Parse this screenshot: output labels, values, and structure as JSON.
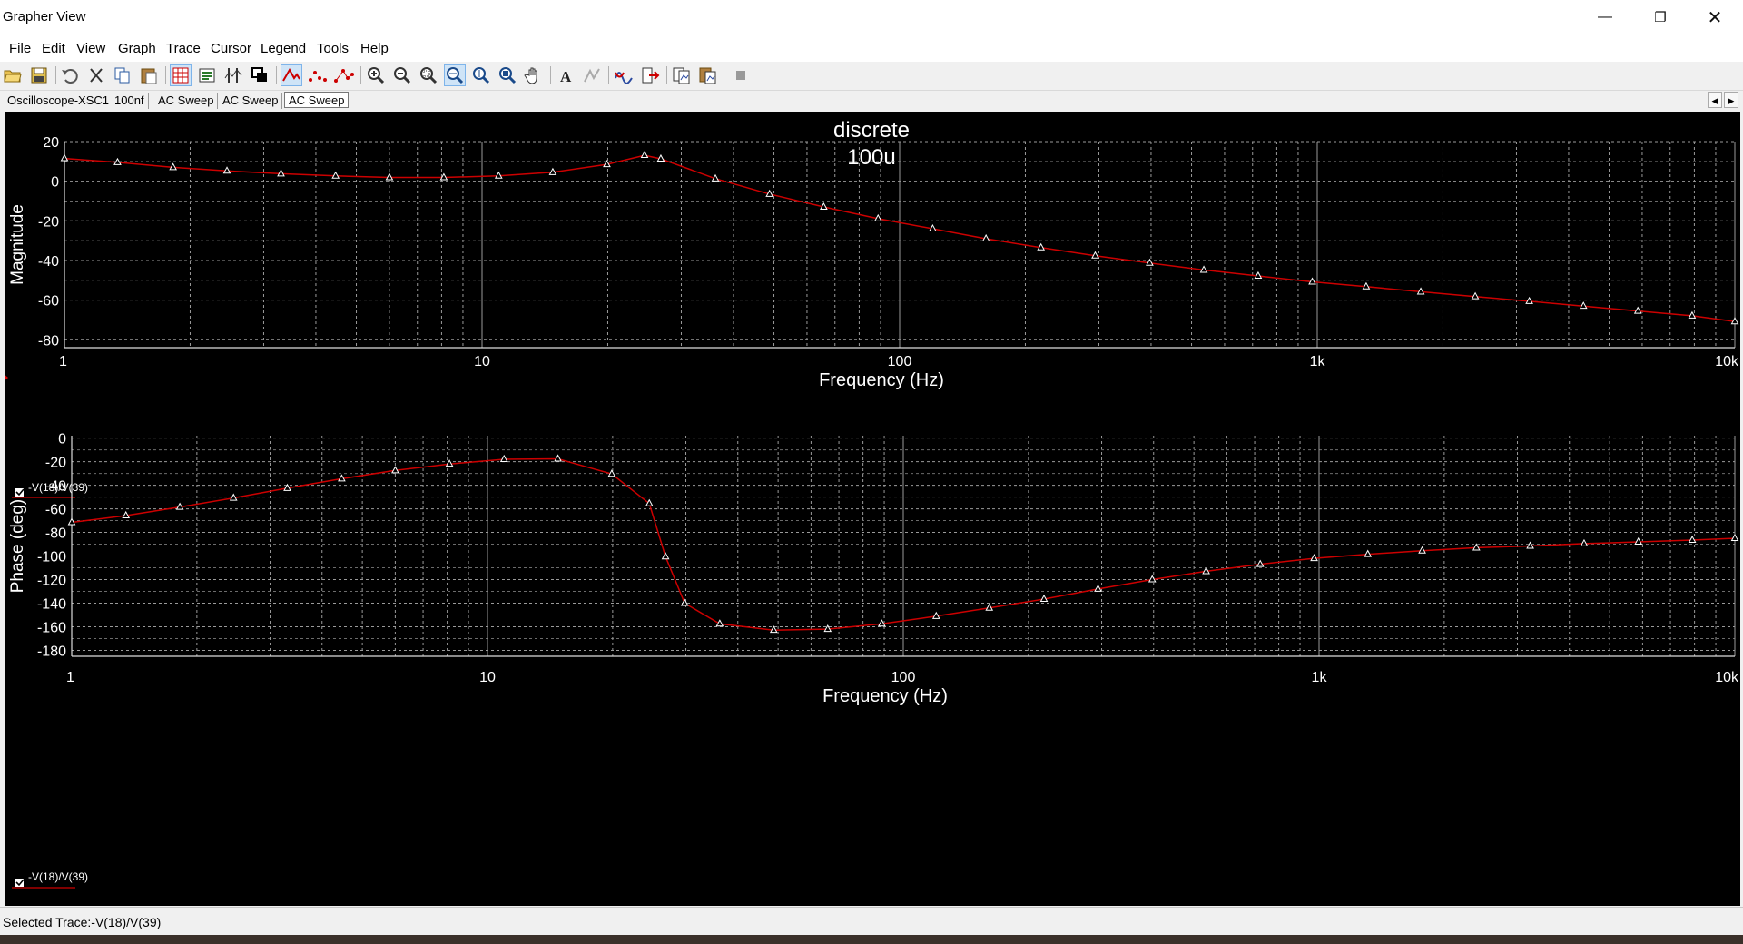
{
  "window": {
    "title": "Grapher View"
  },
  "menu": [
    "File",
    "Edit",
    "View",
    "Graph",
    "Trace",
    "Cursor",
    "Legend",
    "Tools",
    "Help"
  ],
  "toolbar_icons": [
    "open-icon",
    "save-icon",
    "undo-icon",
    "cut-icon",
    "copy-icon",
    "paste-icon",
    "grid-icon",
    "legend-icon",
    "cursors-icon",
    "overlay-icon",
    "lines-icon",
    "dots-icon",
    "dots-lines-icon",
    "zoom-in-icon",
    "zoom-out-icon",
    "zoom-area-icon",
    "zoom-x-icon",
    "zoom-y-icon",
    "zoom-full-icon",
    "pan-icon",
    "text-icon",
    "properties-icon",
    "reverse-colors-icon",
    "export-icon",
    "copy-graph-icon",
    "paste-graph-icon",
    "stop-icon"
  ],
  "tabs": [
    "Oscilloscope-XSC1",
    "100nf",
    "AC Sweep",
    "AC Sweep",
    "AC Sweep"
  ],
  "active_tab": 4,
  "plot": {
    "title_line1": "discrete",
    "title_line2": "100u",
    "background": "#000000",
    "trace_color": "#cc0000",
    "grid_color": "#9a9a9a",
    "text_color": "#ffffff"
  },
  "legend": {
    "label": "-V(18)/V(39)",
    "checked": true
  },
  "status": {
    "text": "Selected Trace:-V(18)/V(39)"
  },
  "chart_data": [
    {
      "type": "line",
      "title": "discrete 100u",
      "xlabel": "Frequency (Hz)",
      "ylabel": "Magnitude",
      "xscale": "log",
      "xlim": [
        1,
        10000
      ],
      "ylim": [
        -84,
        20
      ],
      "grid": true,
      "xticks": [
        {
          "v": 1,
          "t": "1"
        },
        {
          "v": 10,
          "t": "10"
        },
        {
          "v": 100,
          "t": "100"
        },
        {
          "v": 1000,
          "t": "1k"
        },
        {
          "v": 10000,
          "t": "10k"
        }
      ],
      "yticks": [
        20,
        0,
        -20,
        -40,
        -60,
        -80
      ],
      "series": [
        {
          "name": "-V(18)/V(39)",
          "x": [
            1,
            1.34,
            1.82,
            2.45,
            3.3,
            4.46,
            6.0,
            8.1,
            10.96,
            14.77,
            19.9,
            24.5,
            26.8,
            36.2,
            48.8,
            65.8,
            88.8,
            120,
            161,
            218,
            294,
            397,
            535,
            722,
            973,
            1310,
            1770,
            2390,
            3220,
            4340,
            5860,
            7900,
            10000
          ],
          "y": [
            11.5,
            9.5,
            7,
            5.2,
            3.8,
            2.7,
            1.9,
            1.9,
            2.7,
            4.5,
            8.5,
            13.1,
            11.3,
            1.3,
            -6.5,
            -13,
            -18.9,
            -24,
            -29,
            -33.5,
            -37.6,
            -41.3,
            -44.8,
            -47.8,
            -50.8,
            -53.2,
            -55.8,
            -58.2,
            -60.6,
            -63,
            -65.5,
            -67.9,
            -70.8
          ]
        }
      ]
    },
    {
      "type": "line",
      "xlabel": "Frequency (Hz)",
      "ylabel": "Phase (deg)",
      "xscale": "log",
      "xlim": [
        1,
        10000
      ],
      "ylim": [
        -185,
        2
      ],
      "grid": true,
      "xticks": [
        {
          "v": 1,
          "t": "1"
        },
        {
          "v": 10,
          "t": "10"
        },
        {
          "v": 100,
          "t": "100"
        },
        {
          "v": 1000,
          "t": "1k"
        },
        {
          "v": 10000,
          "t": "10k"
        }
      ],
      "yticks": [
        0,
        -20,
        -40,
        -60,
        -80,
        -100,
        -120,
        -140,
        -160,
        -180
      ],
      "series": [
        {
          "name": "-V(18)/V(39)",
          "x": [
            1,
            1.35,
            1.82,
            2.45,
            3.3,
            4.46,
            6.0,
            8.1,
            10.96,
            14.77,
            19.9,
            24.5,
            26.8,
            29.8,
            36.2,
            48.8,
            65.8,
            88.8,
            120,
            161,
            218,
            294,
            397,
            535,
            722,
            973,
            1310,
            1770,
            2390,
            3220,
            4340,
            5860,
            7900,
            10000
          ],
          "y": [
            -71.5,
            -65.7,
            -58.5,
            -50.8,
            -42.5,
            -34.5,
            -27.5,
            -22,
            -18,
            -17.6,
            -30.5,
            -55.5,
            -100.5,
            -140,
            -157.5,
            -162.8,
            -162,
            -157.5,
            -151,
            -144,
            -136.5,
            -128,
            -120,
            -113,
            -107,
            -102,
            -98.5,
            -95.5,
            -93,
            -91.5,
            -89.5,
            -88,
            -86.5,
            -85
          ]
        }
      ]
    }
  ]
}
